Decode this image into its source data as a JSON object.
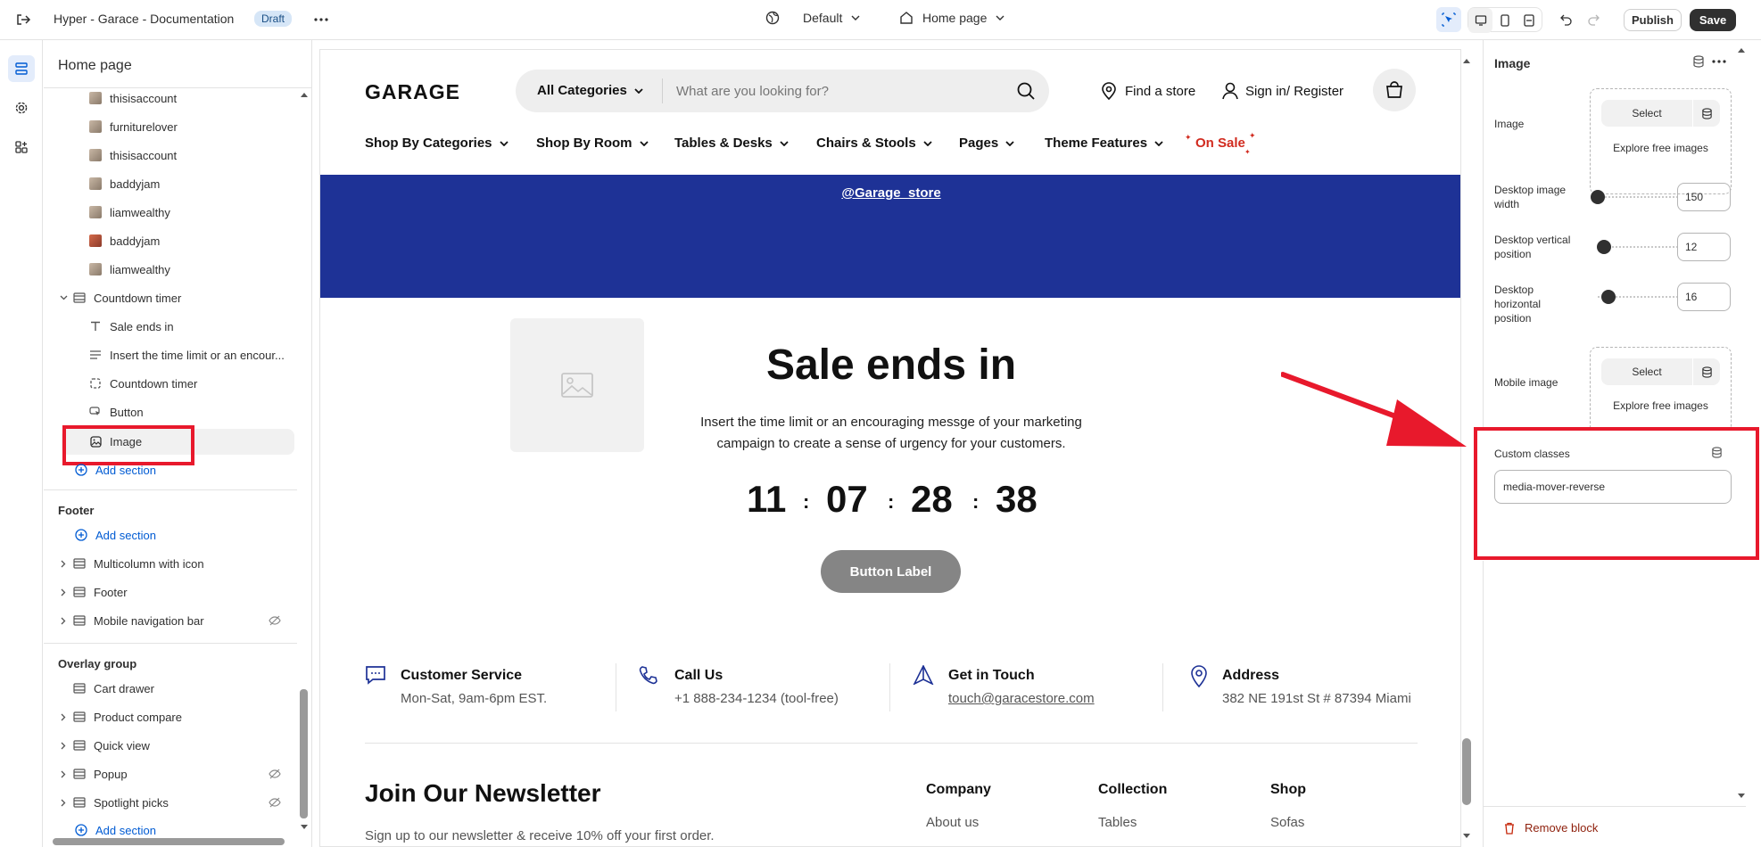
{
  "topbar": {
    "store_name": "Hyper - Garace - Documentation",
    "status_badge": "Draft",
    "theme_select": "Default",
    "page_select": "Home page",
    "publish_label": "Publish",
    "save_label": "Save"
  },
  "left_panel": {
    "title": "Home page",
    "blocks": [
      {
        "label": "thisisaccount",
        "thumb": "avatar"
      },
      {
        "label": "furniturelover",
        "thumb": "avatar"
      },
      {
        "label": "thisisaccount",
        "thumb": "avatar"
      },
      {
        "label": "baddyjam",
        "thumb": "avatar"
      },
      {
        "label": "liamwealthy",
        "thumb": "avatar"
      },
      {
        "label": "baddyjam",
        "thumb": "avatar-red"
      },
      {
        "label": "liamwealthy",
        "thumb": "avatar"
      }
    ],
    "countdown_section": "Countdown timer",
    "countdown_blocks": [
      {
        "label": "Sale ends in",
        "icon": "text-icon"
      },
      {
        "label": "Insert the time limit or an encour...",
        "icon": "paragraph-icon"
      },
      {
        "label": "Countdown timer",
        "icon": "dashed-frame-icon"
      },
      {
        "label": "Button",
        "icon": "button-cursor-icon"
      },
      {
        "label": "Image",
        "icon": "image-icon"
      }
    ],
    "add_section": "Add section",
    "footer_group": "Footer",
    "footer_add_section": "Add section",
    "footer_items": [
      "Multicolumn with icon",
      "Footer",
      "Mobile navigation bar"
    ],
    "overlay_group": "Overlay group",
    "overlay_items": [
      "Cart drawer",
      "Product compare",
      "Quick view",
      "Popup",
      "Spotlight picks"
    ],
    "overlay_add_section": "Add section"
  },
  "preview": {
    "logo": "GARAGE",
    "category_select": "All Categories",
    "search_placeholder": "What are you looking for?",
    "find_store": "Find a store",
    "sign_in": "Sign in/ Register",
    "nav": [
      "Shop By Categories",
      "Shop By Room",
      "Tables & Desks",
      "Chairs & Stools",
      "Pages",
      "Theme Features",
      "On Sale"
    ],
    "instagram_handle": "@Garage_store",
    "sale_heading": "Sale ends in",
    "sale_text_line1": "Insert the time limit or an encouraging messge of your marketing",
    "sale_text_line2": "campaign to create a sense of urgency for your customers.",
    "timer": {
      "days": "11",
      "hours": "07",
      "minutes": "28",
      "seconds": "38",
      "separator": ":"
    },
    "button_label": "Button Label",
    "info": [
      {
        "title": "Customer Service",
        "sub": "Mon-Sat, 9am-6pm EST."
      },
      {
        "title": "Call Us",
        "sub": "+1 888-234-1234 (tool-free)"
      },
      {
        "title": "Get in Touch",
        "sub": "touch@garacestore.com"
      },
      {
        "title": "Address",
        "sub": "382 NE 191st St # 87394 Miami"
      }
    ],
    "newsletter_title": "Join Our Newsletter",
    "newsletter_text": "Sign up to our newsletter & receive 10% off your first order.",
    "footer_cols": [
      {
        "heading": "Company",
        "link": "About us"
      },
      {
        "heading": "Collection",
        "link": "Tables"
      },
      {
        "heading": "Shop",
        "link": "Sofas"
      }
    ]
  },
  "right_panel": {
    "title": "Image",
    "image_label": "Image",
    "select_label": "Select",
    "explore_label": "Explore free images",
    "desktop_width_label": "Desktop image width",
    "desktop_width_value": "150",
    "desktop_vertical_label": "Desktop vertical position",
    "desktop_vertical_value": "12",
    "desktop_horizontal_label": "Desktop horizontal position",
    "desktop_horizontal_value": "16",
    "mobile_image_label": "Mobile image",
    "mobile_select_label": "Select",
    "mobile_explore_label": "Explore free images",
    "custom_classes_label": "Custom classes",
    "custom_classes_value": "media-mover-reverse",
    "remove_block": "Remove block"
  },
  "colors": {
    "accent_blue": "#1e3296",
    "highlight_red": "#e8192c",
    "link_blue": "#005bd3",
    "sale_red": "#d12b1f"
  }
}
